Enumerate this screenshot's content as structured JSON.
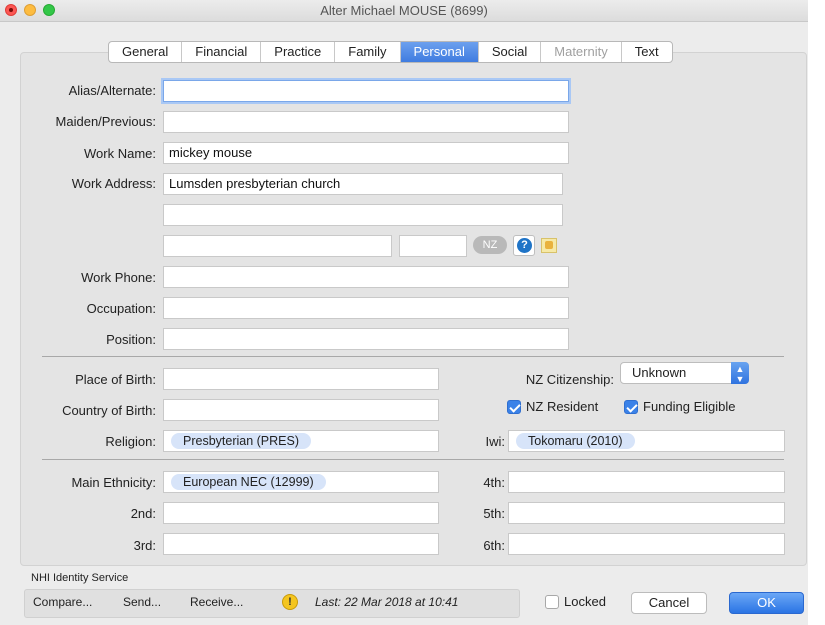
{
  "window": {
    "title": "Alter Michael MOUSE (8699)"
  },
  "tabs": [
    {
      "label": "General",
      "state": "normal"
    },
    {
      "label": "Financial",
      "state": "normal"
    },
    {
      "label": "Practice",
      "state": "normal"
    },
    {
      "label": "Family",
      "state": "normal"
    },
    {
      "label": "Personal",
      "state": "active"
    },
    {
      "label": "Social",
      "state": "normal"
    },
    {
      "label": "Maternity",
      "state": "disabled"
    },
    {
      "label": "Text",
      "state": "normal"
    }
  ],
  "personal": {
    "alias_label": "Alias/Alternate:",
    "alias_value": "",
    "maiden_label": "Maiden/Previous:",
    "maiden_value": "",
    "work_name_label": "Work Name:",
    "work_name_value": "mickey mouse",
    "work_address_label": "Work Address:",
    "work_address_line1": "Lumsden presbyterian church",
    "work_address_line2": "",
    "work_address_city": "",
    "work_address_postcode": "",
    "country_button": "NZ",
    "work_phone_label": "Work Phone:",
    "work_phone_value": "",
    "occupation_label": "Occupation:",
    "occupation_value": "",
    "position_label": "Position:",
    "position_value": "",
    "place_of_birth_label": "Place of Birth:",
    "place_of_birth_value": "",
    "country_of_birth_label": "Country of Birth:",
    "country_of_birth_value": "",
    "religion_label": "Religion:",
    "religion_value": "Presbyterian (PRES)",
    "nz_citizenship_label": "NZ Citizenship:",
    "nz_citizenship_value": "Unknown",
    "nz_resident_label": "NZ Resident",
    "nz_resident_checked": true,
    "funding_eligible_label": "Funding Eligible",
    "funding_eligible_checked": true,
    "iwi_label": "Iwi:",
    "iwi_value": "Tokomaru (2010)"
  },
  "ethnicity": {
    "main_label": "Main Ethnicity:",
    "main_value": "European NEC (12999)",
    "second_label": "2nd:",
    "second_value": "",
    "third_label": "3rd:",
    "third_value": "",
    "fourth_label": "4th:",
    "fourth_value": "",
    "fifth_label": "5th:",
    "fifth_value": "",
    "sixth_label": "6th:",
    "sixth_value": ""
  },
  "nhi": {
    "title": "NHI Identity Service",
    "compare": "Compare...",
    "send": "Send...",
    "receive": "Receive...",
    "warning_glyph": "!",
    "last": "Last: 22 Mar 2018 at 10:41"
  },
  "footer": {
    "locked_label": "Locked",
    "locked_checked": false,
    "cancel": "Cancel",
    "ok": "OK"
  },
  "colors": {
    "accent": "#3b82e8",
    "chip": "#d7e4f9",
    "warning": "#f4c51f"
  }
}
